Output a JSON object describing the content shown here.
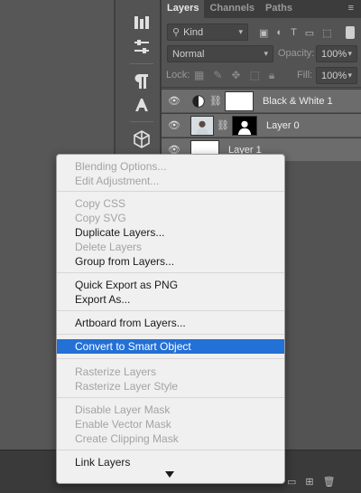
{
  "panel": {
    "tabs": [
      "Layers",
      "Channels",
      "Paths"
    ],
    "panel_menu_glyph": "≡",
    "filter": {
      "label": "Kind",
      "caret": "▾"
    },
    "blend": {
      "value": "Normal",
      "caret": "▾"
    },
    "opacity": {
      "label": "Opacity:",
      "value": "100%",
      "caret": "▾"
    },
    "lock_label": "Lock:",
    "fill": {
      "label": "Fill:",
      "value": "100%",
      "caret": "▾"
    }
  },
  "layers": [
    {
      "name": "Black & White 1",
      "type": "adjustment",
      "selected": true
    },
    {
      "name": "Layer 0",
      "type": "masked-photo",
      "selected": true
    },
    {
      "name": "Layer 1",
      "type": "pixel",
      "selected": true
    }
  ],
  "context_menu": {
    "groups": [
      [
        {
          "label": "Blending Options...",
          "enabled": false
        },
        {
          "label": "Edit Adjustment...",
          "enabled": false
        }
      ],
      [
        {
          "label": "Copy CSS",
          "enabled": false
        },
        {
          "label": "Copy SVG",
          "enabled": false
        },
        {
          "label": "Duplicate Layers...",
          "enabled": true
        },
        {
          "label": "Delete Layers",
          "enabled": false
        },
        {
          "label": "Group from Layers...",
          "enabled": true
        }
      ],
      [
        {
          "label": "Quick Export as PNG",
          "enabled": true
        },
        {
          "label": "Export As...",
          "enabled": true
        }
      ],
      [
        {
          "label": "Artboard from Layers...",
          "enabled": true
        }
      ],
      [
        {
          "label": "Convert to Smart Object",
          "enabled": true,
          "highlighted": true
        }
      ],
      [
        {
          "label": "Rasterize Layers",
          "enabled": false
        },
        {
          "label": "Rasterize Layer Style",
          "enabled": false
        }
      ],
      [
        {
          "label": "Disable Layer Mask",
          "enabled": false
        },
        {
          "label": "Enable Vector Mask",
          "enabled": false
        },
        {
          "label": "Create Clipping Mask",
          "enabled": false
        }
      ],
      [
        {
          "label": "Link Layers",
          "enabled": true
        }
      ]
    ],
    "has_more_indicator": true
  },
  "colors": {
    "highlight": "#2370d6",
    "menu_bg": "#f0f0f0",
    "panel_bg": "#535353"
  }
}
